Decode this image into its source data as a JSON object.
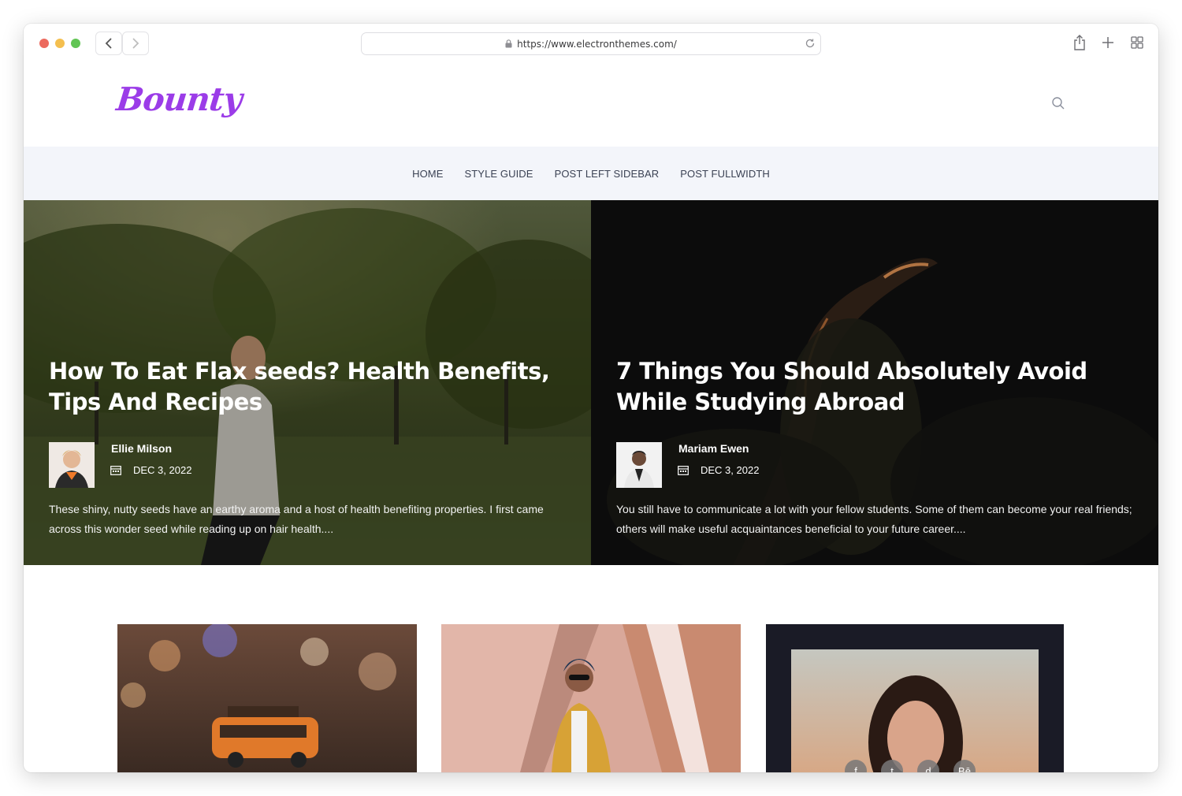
{
  "browser": {
    "url": "https://www.electronthemes.com/",
    "traffic_lights": [
      "#ec6a5e",
      "#f4bf4f",
      "#61c554"
    ]
  },
  "site": {
    "logo": "Bounty",
    "brand_color": "#9b3ce8",
    "nav": [
      "HOME",
      "STYLE GUIDE",
      "POST LEFT SIDEBAR",
      "POST FULLWIDTH"
    ]
  },
  "hero": [
    {
      "title": "How To Eat Flax seeds? Health Benefits, Tips And Recipes",
      "author": "Ellie Milson",
      "date": "DEC 3, 2022",
      "excerpt": "These shiny, nutty seeds have an earthy aroma and a host of health benefiting properties. I first came across this wonder seed while reading up on hair health...."
    },
    {
      "title": "7 Things You Should Absolutely Avoid While Studying Abroad",
      "author": "Mariam Ewen",
      "date": "DEC 3, 2022",
      "excerpt": "You still have to communicate a lot with your fellow students. Some of them can become your real friends; others will make useful acquaintances beneficial to your future career...."
    }
  ],
  "cards": {
    "social_icons": [
      "f",
      "t",
      "d",
      "Bē"
    ]
  }
}
